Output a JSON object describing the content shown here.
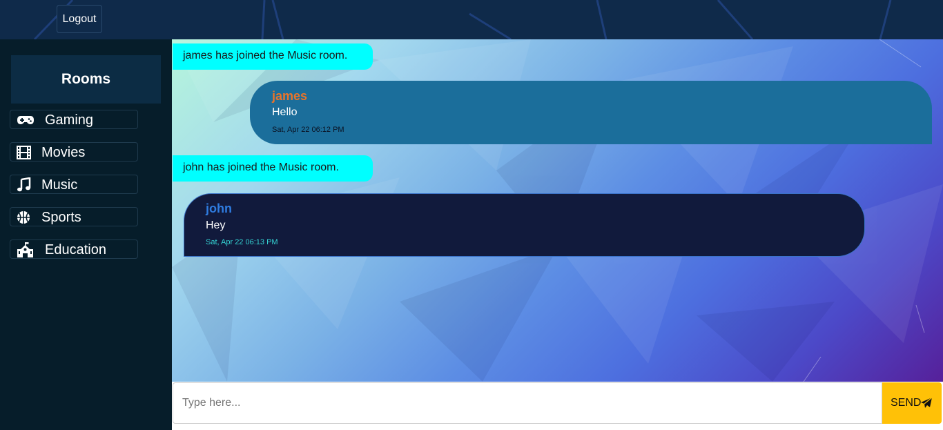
{
  "header": {
    "logout_label": "Logout"
  },
  "sidebar": {
    "title": "Rooms",
    "rooms": [
      {
        "label": "Gaming",
        "icon": "gamepad-icon"
      },
      {
        "label": "Movies",
        "icon": "film-icon"
      },
      {
        "label": "Music",
        "icon": "music-icon"
      },
      {
        "label": "Sports",
        "icon": "basketball-icon"
      },
      {
        "label": "Education",
        "icon": "school-icon"
      }
    ]
  },
  "chat": {
    "messages": [
      {
        "type": "system",
        "text": "james has joined the Music room."
      },
      {
        "type": "user",
        "author": "james",
        "text": "Hello",
        "time": "Sat, Apr 22 06:12 PM"
      },
      {
        "type": "system",
        "text": "john has joined the Music room."
      },
      {
        "type": "user",
        "author": "john",
        "text": "Hey",
        "time": "Sat, Apr 22 06:13 PM"
      }
    ]
  },
  "composer": {
    "placeholder": "Type here...",
    "send_label": "SEND",
    "send_icon": "paper-plane-icon"
  },
  "colors": {
    "system_bg": "#00ffff",
    "send_button": "#ffc107",
    "sent_bubble": "#1b6e9b",
    "received_bubble": "#111a3c"
  }
}
